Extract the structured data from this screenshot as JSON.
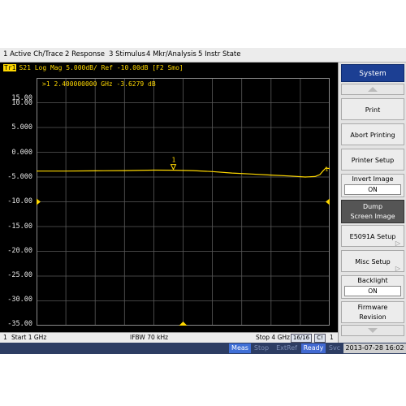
{
  "menu": [
    "1 Active Ch/Trace",
    "2 Response",
    "3 Stimulus",
    "4 Mkr/Analysis",
    "5 Instr State"
  ],
  "trace": {
    "tag": "Tr1",
    "info": "S21 Log Mag 5.000dB/ Ref -10.00dB [F2 Smo]",
    "marker_readout": ">1  2.400000000 GHz -3.6279 dB",
    "marker_label": "1",
    "color": "#ffd800"
  },
  "chart_data": {
    "type": "line",
    "x_unit": "GHz",
    "xlim": [
      1,
      4
    ],
    "ylim": [
      -35,
      15
    ],
    "y_ticks": [
      "15.00",
      "10.00",
      "5.000",
      "0.000",
      "-5.000",
      "-10.00",
      "-15.00",
      "-20.00",
      "-25.00",
      "-30.00",
      "-35.00"
    ],
    "ref_level": -10,
    "grid": true,
    "series": [
      {
        "x": [
          1.0,
          1.3,
          1.6,
          1.9,
          2.2,
          2.4,
          2.6,
          2.8,
          3.0,
          3.2,
          3.4,
          3.6,
          3.75,
          3.85,
          3.9,
          3.93,
          3.96,
          4.0
        ],
        "y": [
          -3.8,
          -3.8,
          -3.75,
          -3.7,
          -3.6,
          -3.63,
          -3.7,
          -3.9,
          -4.2,
          -4.4,
          -4.6,
          -4.8,
          -5.0,
          -4.9,
          -4.5,
          -3.8,
          -3.2,
          -3.3
        ]
      }
    ],
    "markers": [
      {
        "x": 2.4,
        "y": -3.6279,
        "label": "1"
      }
    ]
  },
  "status": {
    "channel": "1",
    "start": "Start 1 GHz",
    "ifbw": "IFBW 70 kHz",
    "stop": "Stop 4 GHz",
    "points": "16/16",
    "flag": "C!",
    "end": "1"
  },
  "taskbar": {
    "meas": "Meas",
    "stop": "Stop",
    "extref": "ExtRef",
    "ready": "Ready",
    "svc": "Svc",
    "datetime": "2013-07-28 16:02"
  },
  "sidebar": {
    "title": "System",
    "print": "Print",
    "abort_printing": "Abort Printing",
    "printer_setup": "Printer Setup",
    "invert_image": "Invert Image",
    "invert_image_value": "ON",
    "dump_screen_1": "Dump",
    "dump_screen_2": "Screen Image",
    "e5091a_setup": "E5091A Setup",
    "misc_setup": "Misc Setup",
    "backlight": "Backlight",
    "backlight_value": "ON",
    "firmware_1": "Firmware",
    "firmware_2": "Revision"
  }
}
